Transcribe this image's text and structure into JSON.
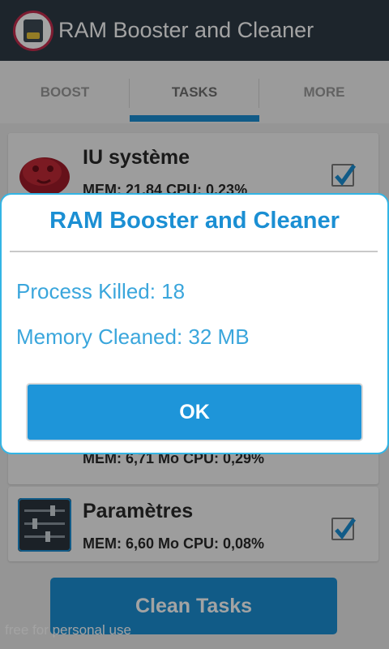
{
  "app": {
    "title": "RAM Booster and Cleaner",
    "icon": "broom-icon"
  },
  "tabs": [
    {
      "label": "BOOST",
      "active": false
    },
    {
      "label": "TASKS",
      "active": true
    },
    {
      "label": "MORE",
      "active": false
    }
  ],
  "tasks": [
    {
      "name": "IU système",
      "stats": "MEM: 21,84      CPU: 0,23%",
      "icon": "android-icon",
      "checked": true
    },
    {
      "name": "",
      "stats": "MEM: 6,71 Mo   CPU: 0,29%",
      "icon": "shield-icon",
      "checked": true
    },
    {
      "name": "Paramètres",
      "stats": "MEM: 6,60 Mo   CPU: 0,08%",
      "icon": "settings-sliders-icon",
      "checked": true
    }
  ],
  "clean_button": "Clean Tasks",
  "watermark": "free for personal use",
  "dialog": {
    "title": "RAM Booster and Cleaner",
    "line1": "Process Killed: 18",
    "line2": "Memory Cleaned: 32 MB",
    "ok_label": "OK"
  },
  "colors": {
    "accent": "#1b8fd3",
    "actionbar": "#2e3b46",
    "dialog_border": "#33b5e5"
  }
}
